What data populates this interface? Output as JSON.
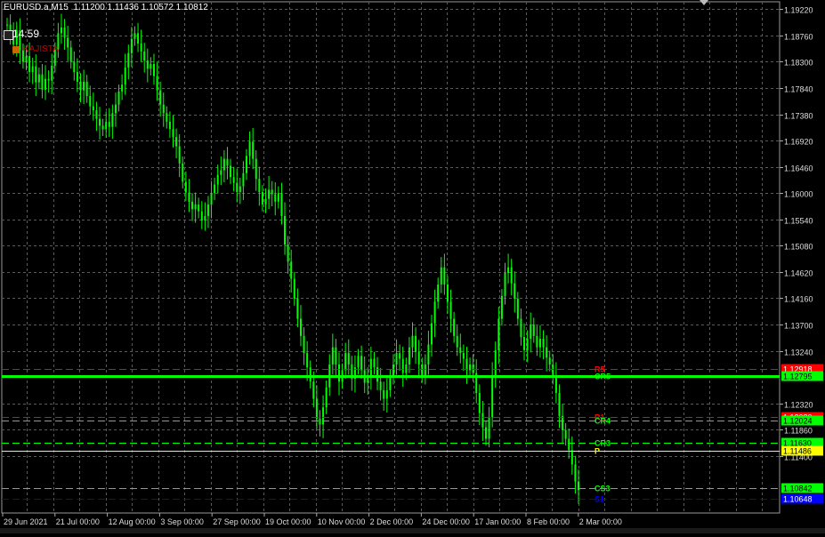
{
  "header": {
    "symbol": "EURUSD.a,M15",
    "ohlc": "1.11200 1.11436 1.10572 1.10812"
  },
  "clock": "14:59",
  "brand": "KAJISTA",
  "colors": {
    "background": "#000000",
    "grid": "#5a5a5a",
    "candles": "#00ff00",
    "red_line": "#ff0000",
    "green_line": "#00ff00",
    "blue_line": "#0000ff",
    "label_red": "#cc0000",
    "label_green": "#00cc00",
    "label_yellow": "#ffff00",
    "label_blue": "#0000ff"
  },
  "chart_data": {
    "type": "line",
    "price_ticks": [
      "1.19220",
      "1.18760",
      "1.18300",
      "1.17840",
      "1.17380",
      "1.16920",
      "1.16460",
      "1.16000",
      "1.15540",
      "1.15080",
      "1.14620",
      "1.14160",
      "1.13700",
      "1.13240",
      "1.12320",
      "1.11860",
      "1.11400"
    ],
    "ylim": [
      1.104,
      1.1935
    ],
    "time_labels": [
      "29 Jun 2021",
      "21 Jul 00:00",
      "12 Aug 00:00",
      "3 Sep 00:00",
      "27 Sep 00:00",
      "19 Oct 00:00",
      "10 Nov 00:00",
      "2 Dec 00:00",
      "24 Dec 00:00",
      "17 Jan 00:00",
      "8 Feb 00:00",
      "2 Mar 00:00"
    ],
    "series": [
      {
        "values": [
          1.1895,
          1.1875,
          1.186,
          1.1885,
          1.185,
          1.183,
          1.184,
          1.1812,
          1.1822,
          1.1794,
          1.1808,
          1.1781,
          1.18,
          1.1797,
          1.1823,
          1.1852,
          1.188,
          1.189,
          1.1872,
          1.1855,
          1.183,
          1.1812,
          1.1795,
          1.178,
          1.1795,
          1.177,
          1.1752,
          1.1745,
          1.173,
          1.1718,
          1.1712,
          1.1725,
          1.1716,
          1.174,
          1.1755,
          1.1778,
          1.179,
          1.182,
          1.1845,
          1.187,
          1.188,
          1.1862,
          1.1848,
          1.1832,
          1.1818,
          1.1826,
          1.1805,
          1.178,
          1.1755,
          1.174,
          1.1725,
          1.1712,
          1.1698,
          1.1682,
          1.1652,
          1.162,
          1.1601,
          1.1585,
          1.1572,
          1.158,
          1.1568,
          1.1552,
          1.156,
          1.158,
          1.16,
          1.1615,
          1.1632,
          1.164,
          1.166,
          1.1648,
          1.1628,
          1.1618,
          1.1602,
          1.1612,
          1.1635,
          1.1665,
          1.169,
          1.166,
          1.1625,
          1.1602,
          1.158,
          1.159,
          1.1606,
          1.1598,
          1.1585,
          1.16,
          1.156,
          1.151,
          1.148,
          1.145,
          1.1415,
          1.138,
          1.135,
          1.132,
          1.1295,
          1.127,
          1.124,
          1.1205,
          1.1195,
          1.1225,
          1.126,
          1.13,
          1.133,
          1.13,
          1.127,
          1.129,
          1.132,
          1.13,
          1.1275,
          1.1295,
          1.1315,
          1.129,
          1.1268,
          1.128,
          1.131,
          1.1295,
          1.127,
          1.1255,
          1.124,
          1.1255,
          1.128,
          1.13,
          1.132,
          1.131,
          1.1285,
          1.13,
          1.133,
          1.135,
          1.1322,
          1.13,
          1.128,
          1.13,
          1.1335,
          1.1372,
          1.141,
          1.144,
          1.147,
          1.144,
          1.141,
          1.138,
          1.135,
          1.133,
          1.132,
          1.131,
          1.129,
          1.13,
          1.1285,
          1.125,
          1.1215,
          1.119,
          1.117,
          1.1208,
          1.128,
          1.1325,
          1.138,
          1.142,
          1.146,
          1.147,
          1.1442,
          1.1415,
          1.138,
          1.1348,
          1.1325,
          1.1345,
          1.137,
          1.135,
          1.133,
          1.1345,
          1.133,
          1.1312,
          1.13,
          1.128,
          1.125,
          1.121,
          1.1185,
          1.117,
          1.115,
          1.1125,
          1.1095,
          1.108
        ]
      }
    ],
    "levels": [
      {
        "label": "R5",
        "value": 1.12918,
        "color": "#ff0000",
        "price_label": "1.12918",
        "style": "dash"
      },
      {
        "label": "CR5",
        "value": 1.12795,
        "color": "#00ff00",
        "price_label": "1.12795",
        "style": "solid",
        "thick": true
      },
      {
        "label": "R1",
        "value": 1.1208,
        "color": "#ff0000",
        "price_label": "1.12080",
        "style": "dash"
      },
      {
        "label": "CR4",
        "value": 1.12024,
        "color": "#00ff00",
        "price_label": "1.12024",
        "style": "dash"
      },
      {
        "label": "CR3",
        "value": 1.1163,
        "color": "#00ff00",
        "price_label": "1.11630",
        "style": "dash"
      },
      {
        "label": "P",
        "value": 1.11486,
        "color": "#ffff00",
        "price_label": "1.11486",
        "style": "solid"
      },
      {
        "label": "CS3",
        "value": 1.10842,
        "color": "#00ff00",
        "price_label": "1.10842",
        "style": "dash"
      },
      {
        "label": "S1",
        "value": 1.10648,
        "color": "#0000ff",
        "price_label": "1.10648",
        "style": "dash"
      }
    ]
  }
}
